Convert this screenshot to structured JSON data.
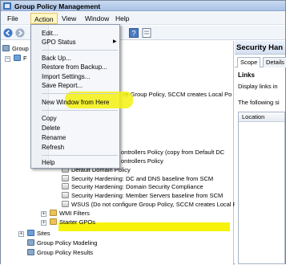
{
  "window": {
    "title": "Group Policy Management"
  },
  "menubar": {
    "items": [
      "File",
      "Action",
      "View",
      "Window",
      "Help"
    ]
  },
  "action_menu": {
    "items": [
      {
        "label": "Edit..."
      },
      {
        "label": "GPO Status",
        "submenu": true
      },
      {
        "separator": true
      },
      {
        "label": "Back Up..."
      },
      {
        "label": "Restore from Backup..."
      },
      {
        "label": "Import Settings...",
        "highlighted": true
      },
      {
        "label": "Save Report..."
      },
      {
        "separator": true
      },
      {
        "label": "New Window from Here"
      },
      {
        "separator": true
      },
      {
        "label": "Copy"
      },
      {
        "label": "Delete"
      },
      {
        "label": "Rename"
      },
      {
        "label": "Refresh"
      },
      {
        "separator": true
      },
      {
        "label": "Help"
      }
    ]
  },
  "tree": {
    "root_partial": "Group",
    "forest_partial": "F",
    "rows": [
      {
        "text": "re Group Policy, SCCM creates Local Po"
      },
      {
        "text": "ontrollers Policy (copy from Default DC"
      },
      {
        "text": "ontrollers Policy"
      },
      {
        "text": "Default Domain Policy"
      },
      {
        "text": "Security Hardening: DC and DNS baseline from SCM"
      },
      {
        "text": "Security Hardening: Domain Security Compliance",
        "highlighted": true
      },
      {
        "text": "Security Hardening: Member Servers baseline from SCM"
      },
      {
        "text": "WSUS (Do not configure Group Policy, SCCM creates Local Po"
      },
      {
        "text": "WMI Filters"
      },
      {
        "text": "Starter GPOs"
      },
      {
        "text": "Sites"
      },
      {
        "text": "Group Policy Modeling"
      },
      {
        "text": "Group Policy Results"
      }
    ]
  },
  "right_pane": {
    "title": "Security Han",
    "tabs": [
      "Scope",
      "Details"
    ],
    "links_heading": "Links",
    "display_text": "Display links in",
    "following_text": "The following si",
    "column": "Location"
  },
  "colors": {
    "highlight": "#f6f20a",
    "titlebar": "#b4cbe9"
  }
}
